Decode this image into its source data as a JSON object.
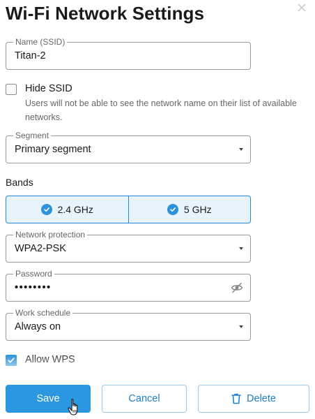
{
  "dialog": {
    "title": "Wi-Fi Network Settings",
    "close_icon": "close-icon"
  },
  "ssid": {
    "label": "Name (SSID)",
    "value": "Titan-2"
  },
  "hide_ssid": {
    "label": "Hide SSID",
    "checked": false,
    "hint": "Users will not be able to see the network name on their list of available networks."
  },
  "segment": {
    "label": "Segment",
    "value": "Primary segment"
  },
  "bands": {
    "label": "Bands",
    "items": [
      {
        "label": "2.4 GHz",
        "checked": true
      },
      {
        "label": "5 GHz",
        "checked": true
      }
    ]
  },
  "protection": {
    "label": "Network protection",
    "value": "WPA2-PSK"
  },
  "password": {
    "label": "Password",
    "masked_value": "••••••••",
    "visibility_icon": "eye-off-icon"
  },
  "schedule": {
    "label": "Work schedule",
    "value": "Always on"
  },
  "wps": {
    "label": "Allow WPS",
    "checked": true
  },
  "footer": {
    "save_label": "Save",
    "cancel_label": "Cancel",
    "delete_label": "Delete",
    "delete_icon": "trash-icon"
  },
  "colors": {
    "accent": "#2b97e0",
    "accent_light": "#e9f3fb",
    "border": "#9a9a9a",
    "text": "#1a1a1a"
  }
}
